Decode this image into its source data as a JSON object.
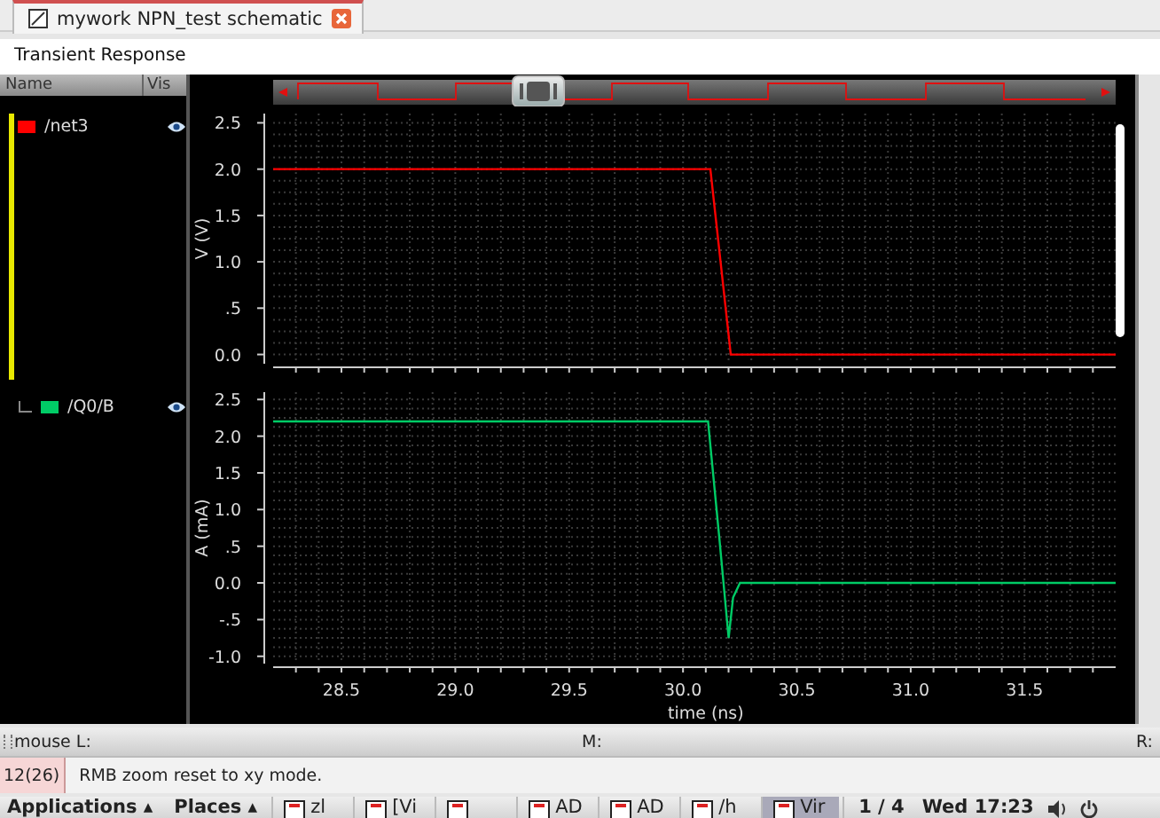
{
  "tabs": [
    {
      "label": "mywork NPN_test schematic",
      "selected": true
    }
  ],
  "window": {
    "title": "Transient Response"
  },
  "legend": {
    "columns": [
      "Name",
      "Vis"
    ]
  },
  "strips": [
    {
      "selected": true,
      "signals": [
        {
          "name": "/net3",
          "color": "#ff0000",
          "visible": true
        }
      ],
      "chart_data": {
        "type": "line",
        "grid": true,
        "ylabel": "V (V)",
        "xlim": [
          28.2,
          31.9
        ],
        "ylim": [
          -0.1,
          2.6
        ],
        "yticks": [
          {
            "value": 2.5,
            "label": "2.5"
          },
          {
            "value": 2.0,
            "label": "2.0"
          },
          {
            "value": 1.5,
            "label": "1.5"
          },
          {
            "value": 1.0,
            "label": "1.0"
          },
          {
            "value": 0.5,
            "label": ".5"
          },
          {
            "value": 0.0,
            "label": "0.0"
          }
        ],
        "x": [
          28.2,
          30.12,
          30.21,
          31.9
        ],
        "series": [
          {
            "color": "#ff0000",
            "values": [
              2.0,
              2.0,
              0.0,
              0.0
            ]
          }
        ]
      }
    },
    {
      "selected": false,
      "signals": [
        {
          "name": "/Q0/B",
          "color": "#00cc66",
          "visible": true
        }
      ],
      "chart_data": {
        "type": "line",
        "grid": true,
        "xlabel": "time (ns)",
        "ylabel": "A (mA)",
        "xlim": [
          28.2,
          31.9
        ],
        "ylim": [
          -1.1,
          2.6
        ],
        "xticks": [
          {
            "value": 28.5,
            "label": "28.5"
          },
          {
            "value": 29.0,
            "label": "29.0"
          },
          {
            "value": 29.5,
            "label": "29.5"
          },
          {
            "value": 30.0,
            "label": "30.0"
          },
          {
            "value": 30.5,
            "label": "30.5"
          },
          {
            "value": 31.0,
            "label": "31.0"
          },
          {
            "value": 31.5,
            "label": "31.5"
          }
        ],
        "yticks": [
          {
            "value": 2.5,
            "label": "2.5"
          },
          {
            "value": 2.0,
            "label": "2.0"
          },
          {
            "value": 1.5,
            "label": "1.5"
          },
          {
            "value": 1.0,
            "label": "1.0"
          },
          {
            "value": 0.5,
            "label": ".5"
          },
          {
            "value": 0.0,
            "label": "0.0"
          },
          {
            "value": -0.5,
            "label": "-.5"
          },
          {
            "value": -1.0,
            "label": "-1.0"
          }
        ],
        "x": [
          28.2,
          30.11,
          30.16,
          30.2,
          30.22,
          30.25,
          31.9
        ],
        "series": [
          {
            "color": "#00cc66",
            "values": [
              2.2,
              2.2,
              0.6,
              -0.75,
              -0.2,
              0.0,
              0.0
            ]
          }
        ]
      }
    }
  ],
  "mouse": {
    "left": "mouse L:",
    "middle": "M:",
    "right": "R:"
  },
  "message": {
    "count": "12(26)",
    "text": "RMB zoom reset to xy mode."
  },
  "taskbar": {
    "menus": [
      "Applications ▴",
      "Places ▴"
    ],
    "windows": [
      {
        "label": "zl",
        "selected": false
      },
      {
        "label": "[Vi",
        "selected": false
      },
      {
        "selected": false
      },
      {
        "label": "AD",
        "selected": false
      },
      {
        "label": "AD",
        "selected": false
      },
      {
        "label": "/h",
        "selected": false
      },
      {
        "label": "Vir",
        "selected": true
      }
    ],
    "workspace": "1 / 4",
    "clock": "Wed 17:23"
  }
}
